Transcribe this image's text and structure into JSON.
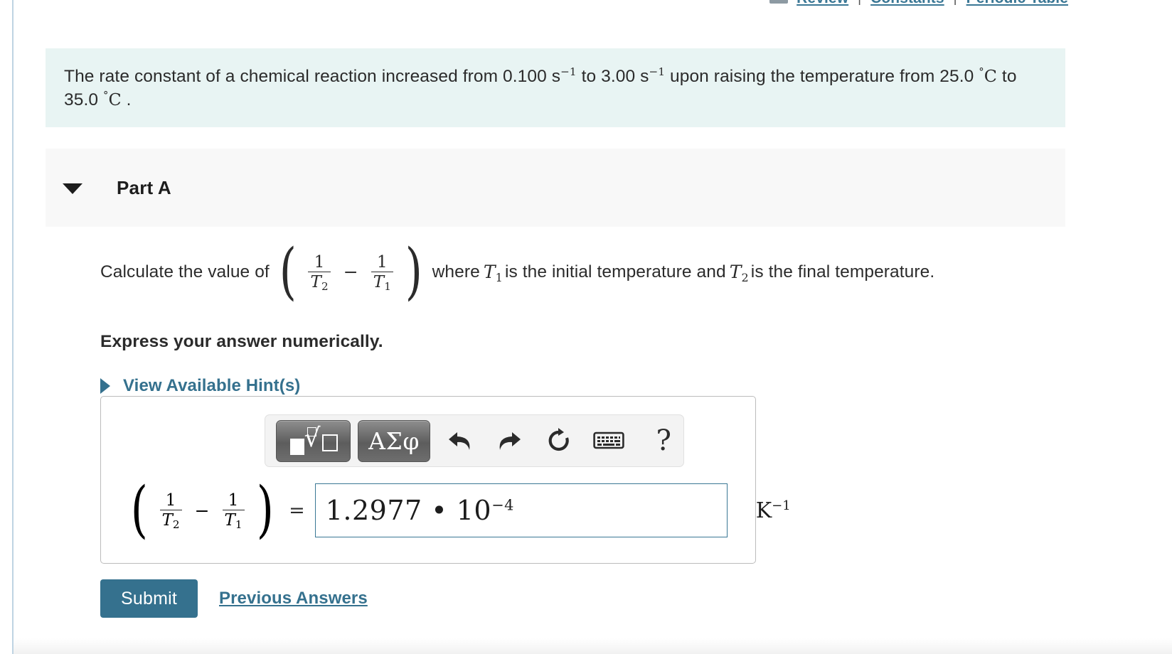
{
  "topnav": {
    "icon": "book-icon",
    "links": [
      "Review",
      "Constants",
      "Periodic Table"
    ],
    "separator": "|"
  },
  "statement": {
    "text_part_1": "The rate constant of a chemical reaction increased from 0.100 s",
    "exp_1": "−1",
    "text_part_2": " to 3.00 s",
    "exp_2": "−1",
    "text_part_3": " upon raising the temperature from 25.0 ",
    "deg_1": "°C",
    "text_part_4": " to 35.0 ",
    "deg_2": "°C",
    "text_part_5": " ."
  },
  "part": {
    "caret": "caret-down-icon",
    "label": "Part A"
  },
  "question": {
    "prefix": "Calculate the value of",
    "expr": {
      "open_paren": "(",
      "close_paren": ")",
      "frac1_num": "1",
      "frac1_den": "T",
      "frac1_den_sub": "2",
      "operator": "−",
      "frac2_num": "1",
      "frac2_den": "T",
      "frac2_den_sub": "1"
    },
    "mid_1": "where",
    "var_T1": "T",
    "var_T1_sub": "1",
    "mid_2": "is the initial temperature and",
    "var_T2": "T",
    "var_T2_sub": "2",
    "suffix": "is the final temperature.",
    "express": "Express your answer numerically.",
    "hints_label": "View Available Hint(s)"
  },
  "toolbar": {
    "template_button": "template-root-icon",
    "greek_button": "ΑΣφ",
    "undo": "undo-icon",
    "redo": "redo-icon",
    "reset": "reset-icon",
    "keyboard": "keyboard-icon",
    "help": "?"
  },
  "answer": {
    "lhs_open_paren": "(",
    "lhs_close_paren": ")",
    "lhs_frac1_num": "1",
    "lhs_frac1_den": "T",
    "lhs_frac1_den_sub": "2",
    "lhs_operator": "−",
    "lhs_frac2_num": "1",
    "lhs_frac2_den": "T",
    "lhs_frac2_den_sub": "1",
    "equals": "=",
    "value_mantissa": "1.2977 • 10",
    "value_exponent": "−4",
    "unit_base": "K",
    "unit_exponent": "−1"
  },
  "actions": {
    "submit_label": "Submit",
    "previous_answers_label": "Previous Answers"
  },
  "colors": {
    "statement_bg": "#e8f4f3",
    "part_bg": "#f8f8f8",
    "accent": "#35718e",
    "input_border": "#3a7795",
    "rail": "#bfd4e3"
  }
}
